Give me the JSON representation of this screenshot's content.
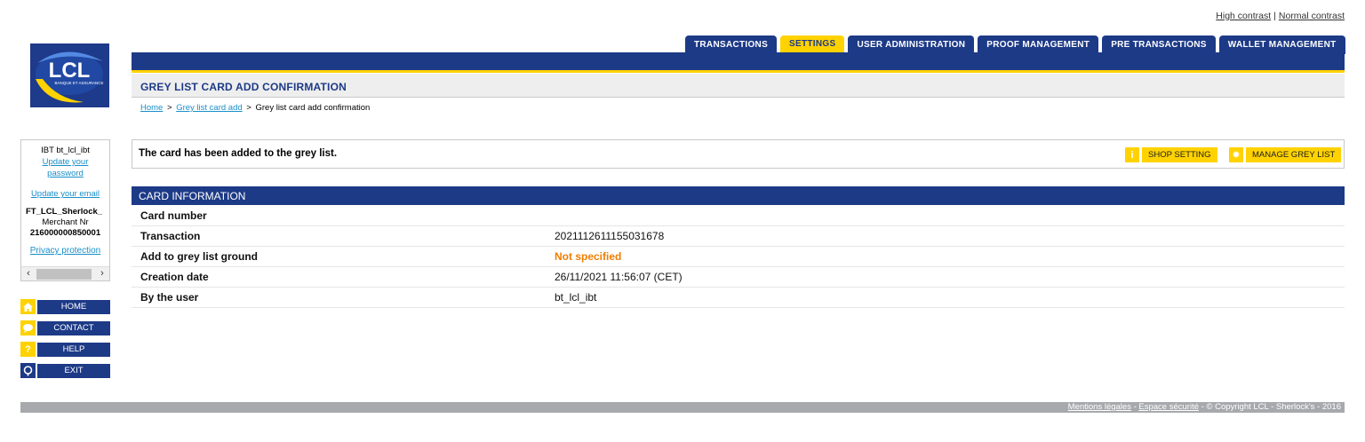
{
  "contrast": {
    "high": "High contrast",
    "separator": "|",
    "normal": "Normal contrast"
  },
  "logo": {
    "text": "LCL",
    "subtitle": "BANQUE ET ASSURANCE",
    "colors": {
      "background": "#1e3a8a",
      "accent": "#ffd200"
    }
  },
  "tabs": [
    {
      "label": "TRANSACTIONS",
      "active": false
    },
    {
      "label": "SETTINGS",
      "active": true
    },
    {
      "label": "USER ADMINISTRATION",
      "active": false
    },
    {
      "label": "PROOF MANAGEMENT",
      "active": false
    },
    {
      "label": "PRE TRANSACTIONS",
      "active": false
    },
    {
      "label": "WALLET MANAGEMENT",
      "active": false
    }
  ],
  "page": {
    "title": "GREY LIST CARD ADD CONFIRMATION"
  },
  "breadcrumb": {
    "home": "Home",
    "sep": ">",
    "greylist_add": "Grey list card add",
    "current": "Grey list card add confirmation"
  },
  "user_panel": {
    "username": "IBT bt_lcl_ibt",
    "update_password": "Update your password",
    "update_email": "Update your email",
    "shop": "FT_LCL_Sherlock_",
    "merchant_label": "Merchant Nr",
    "merchant_number": "216000000850001",
    "privacy": "Privacy protection"
  },
  "leftnav": [
    {
      "label": "HOME",
      "icon": "home-icon"
    },
    {
      "label": "CONTACT",
      "icon": "speech-bubble-icon"
    },
    {
      "label": "HELP",
      "icon": "question-icon"
    },
    {
      "label": "EXIT",
      "icon": "exit-icon"
    }
  ],
  "message": {
    "text": "The card has been added to the grey list.",
    "shop_setting": "SHOP SETTING",
    "manage_grey_list": "MANAGE GREY LIST"
  },
  "card_info": {
    "heading": "CARD INFORMATION",
    "rows": [
      {
        "label": "Card number",
        "value": ""
      },
      {
        "label": "Transaction",
        "value": "2021112611155031678"
      },
      {
        "label": "Add to grey list ground",
        "value": "Not specified"
      },
      {
        "label": "Creation date",
        "value": "26/11/2021 11:56:07 (CET)"
      },
      {
        "label": "By the user",
        "value": "bt_lcl_ibt"
      }
    ]
  },
  "footer": {
    "legal": "Mentions légales",
    "dash1": " - ",
    "security": "Espace sécurité",
    "copyright": " - © Copyright LCL - Sherlock's - 2016"
  },
  "colors": {
    "primary_blue": "#1d3a87",
    "accent_yellow": "#ffd200",
    "warning_orange": "#f07d00",
    "link": "#1a8fc9"
  }
}
